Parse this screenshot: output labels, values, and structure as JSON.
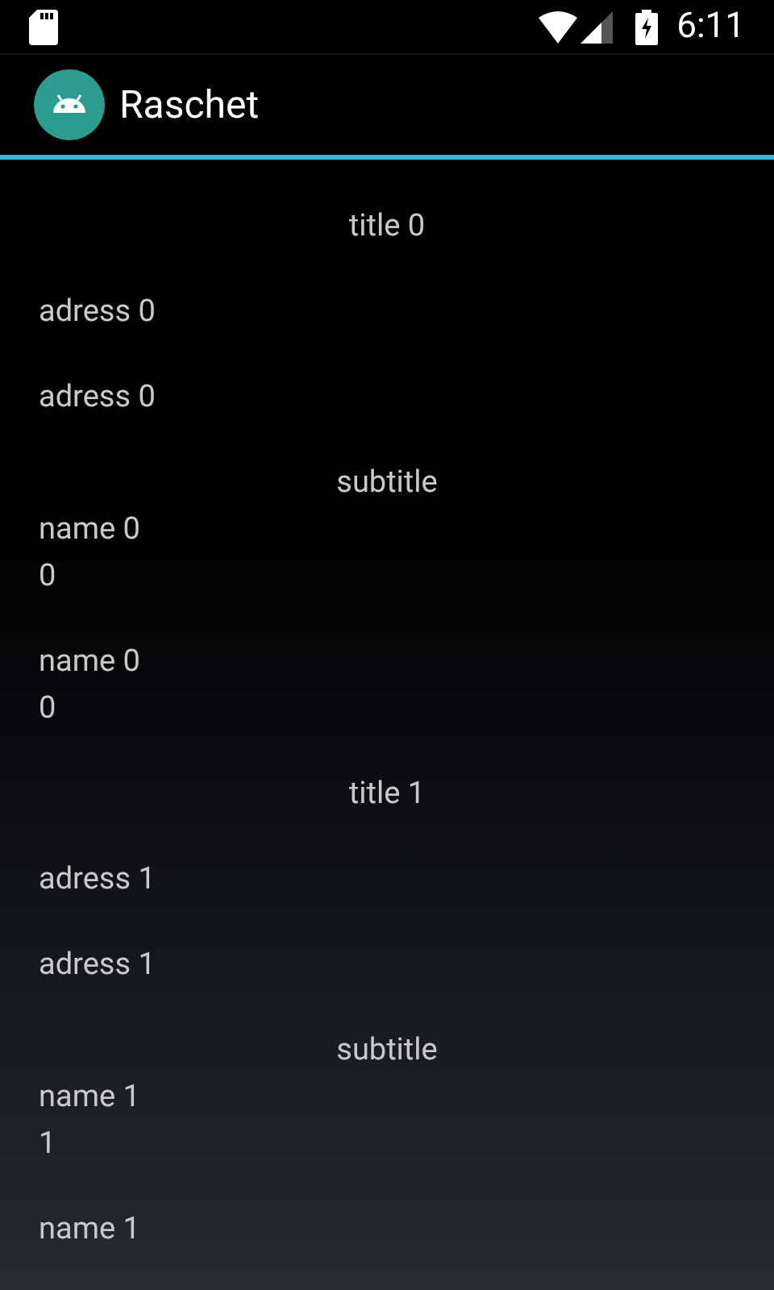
{
  "status_bar": {
    "time": "6:11"
  },
  "app_bar": {
    "title": "Raschet"
  },
  "list": [
    {
      "kind": "title",
      "text": "title 0"
    },
    {
      "kind": "address",
      "text": "adress 0"
    },
    {
      "kind": "address",
      "text": "adress 0"
    },
    {
      "kind": "subtitle",
      "text": "subtitle"
    },
    {
      "kind": "name",
      "text": "name 0",
      "value": "0"
    },
    {
      "kind": "name",
      "text": "name 0",
      "value": "0"
    },
    {
      "kind": "title",
      "text": "title 1"
    },
    {
      "kind": "address",
      "text": "adress 1"
    },
    {
      "kind": "address",
      "text": "adress 1"
    },
    {
      "kind": "subtitle",
      "text": "subtitle"
    },
    {
      "kind": "name",
      "text": "name 1",
      "value": "1"
    },
    {
      "kind": "name",
      "text": "name 1"
    }
  ]
}
